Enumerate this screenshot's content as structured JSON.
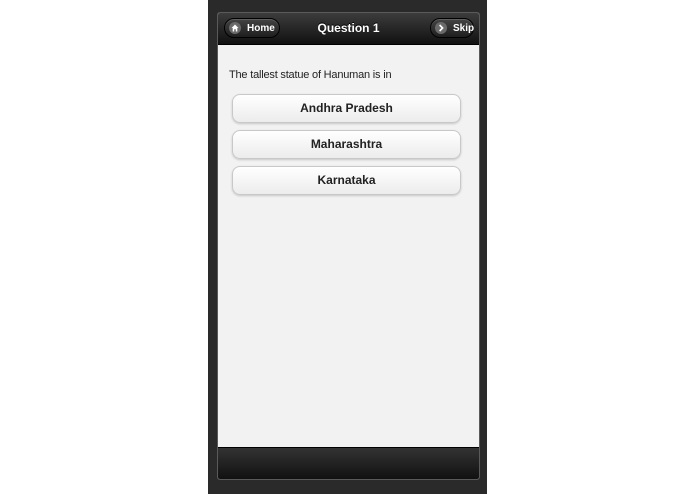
{
  "header": {
    "title": "Question 1",
    "home_label": "Home",
    "skip_label": "Skip",
    "home_icon": "home-icon",
    "skip_icon": "chevron-right-icon"
  },
  "question": {
    "text": "The tallest statue of Hanuman is in"
  },
  "answers": [
    {
      "label": "Andhra Pradesh"
    },
    {
      "label": "Maharashtra"
    },
    {
      "label": "Karnataka"
    }
  ],
  "colors": {
    "bar": "#1a1a1a",
    "screen_bg": "#f2f2f2",
    "device_frame": "#2a2a2a"
  }
}
